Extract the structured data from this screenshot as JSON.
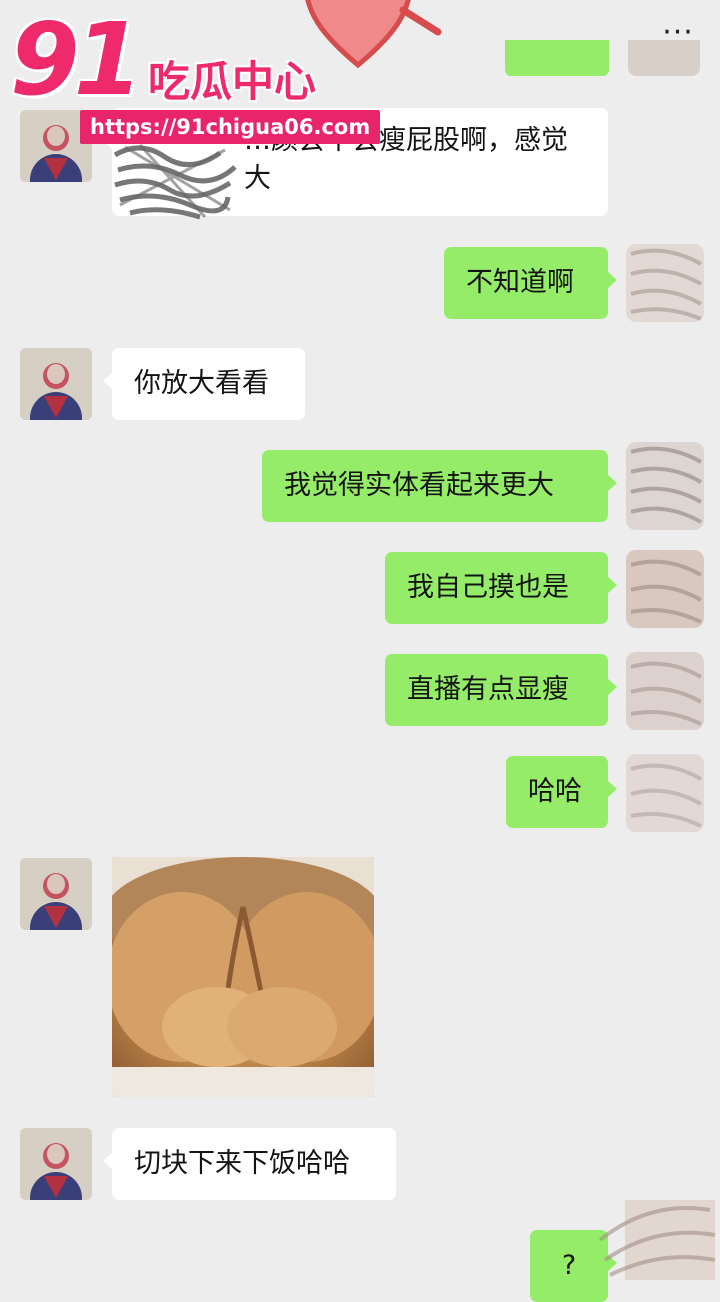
{
  "header": {
    "more_label": "···"
  },
  "watermark": {
    "number": "91",
    "name": "吃瓜中心",
    "url": "https://91chigua06.com"
  },
  "messages": [
    {
      "side": "left",
      "text": "…颜会不会瘦屁股啊，感觉",
      "text2": "大"
    },
    {
      "side": "right",
      "text": "不知道啊"
    },
    {
      "side": "left",
      "text": "你放大看看"
    },
    {
      "side": "right",
      "text": "我觉得实体看起来更大"
    },
    {
      "side": "right",
      "text": "我自己摸也是"
    },
    {
      "side": "right",
      "text": "直播有点显瘦"
    },
    {
      "side": "right",
      "text": "哈哈"
    },
    {
      "side": "left",
      "type": "image",
      "image": "cat-photo"
    },
    {
      "side": "left",
      "text": "切块下来下饭哈哈"
    },
    {
      "side": "right",
      "text": "?"
    }
  ],
  "colors": {
    "background": "#ededed",
    "sent_bubble": "#95ec69",
    "received_bubble": "#ffffff",
    "watermark": "#ef2a6b"
  }
}
